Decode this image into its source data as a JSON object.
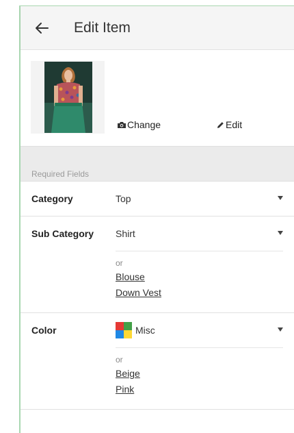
{
  "header": {
    "title": "Edit Item",
    "back_icon": "arrow-left-icon"
  },
  "photo": {
    "alt": "item photo",
    "change_label": "Change",
    "change_icon": "camera-icon",
    "edit_label": "Edit",
    "edit_icon": "pencil-icon"
  },
  "section": {
    "label": "Required Fields"
  },
  "fields": {
    "category": {
      "label": "Category",
      "value": "Top"
    },
    "sub_category": {
      "label": "Sub Category",
      "value": "Shirt",
      "or_text": "or",
      "alternatives": [
        "Blouse",
        "Down Vest"
      ]
    },
    "color": {
      "label": "Color",
      "value": "Misc",
      "swatch_colors": [
        "#e53935",
        "#43a047",
        "#1e88e5",
        "#fdd835"
      ],
      "or_text": "or",
      "alternatives": [
        "Beige",
        "Pink"
      ]
    }
  },
  "colors": {
    "frame_accent": "#a9d7b1",
    "header_bg": "#f5f5f5",
    "section_bg": "#ebebeb"
  }
}
